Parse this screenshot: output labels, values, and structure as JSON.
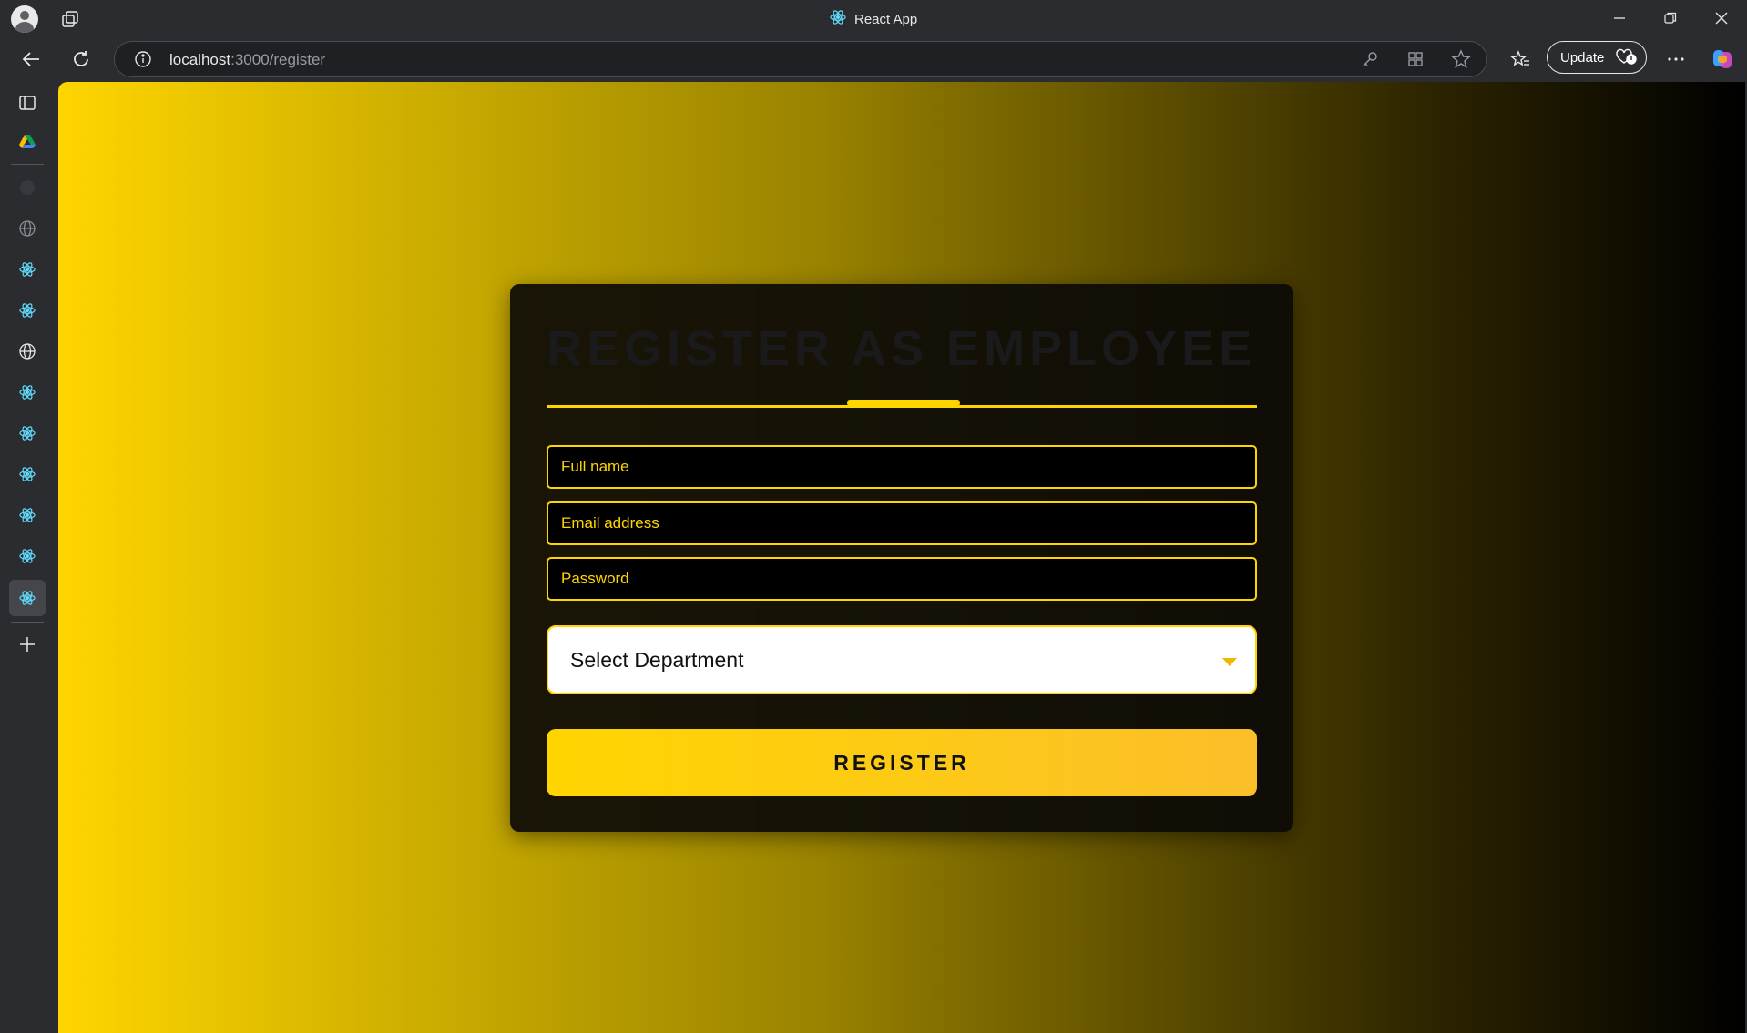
{
  "browser": {
    "tab_title": "React App",
    "url_host": "localhost",
    "url_path": ":3000/register",
    "update_label": "Update"
  },
  "sidebar": {
    "items": [
      {
        "icon": "sidebar-panel-icon"
      },
      {
        "icon": "drive-icon"
      },
      {
        "icon": "github-icon"
      },
      {
        "icon": "globe-icon"
      },
      {
        "icon": "react-icon"
      },
      {
        "icon": "react-icon"
      },
      {
        "icon": "globe-icon"
      },
      {
        "icon": "react-icon"
      },
      {
        "icon": "react-icon"
      },
      {
        "icon": "react-icon"
      },
      {
        "icon": "react-icon"
      },
      {
        "icon": "react-icon"
      },
      {
        "icon": "react-icon",
        "active": true
      }
    ],
    "add_icon": "plus-icon"
  },
  "form": {
    "title": "REGISTER AS EMPLOYEE",
    "full_name_placeholder": "Full name",
    "email_placeholder": "Email address",
    "password_placeholder": "Password",
    "department_selected": "Select Department",
    "submit_label": "REGISTER"
  },
  "colors": {
    "accent": "#ffd500",
    "card_bg": "#0c0a06",
    "button_end": "#fbbf2a"
  }
}
